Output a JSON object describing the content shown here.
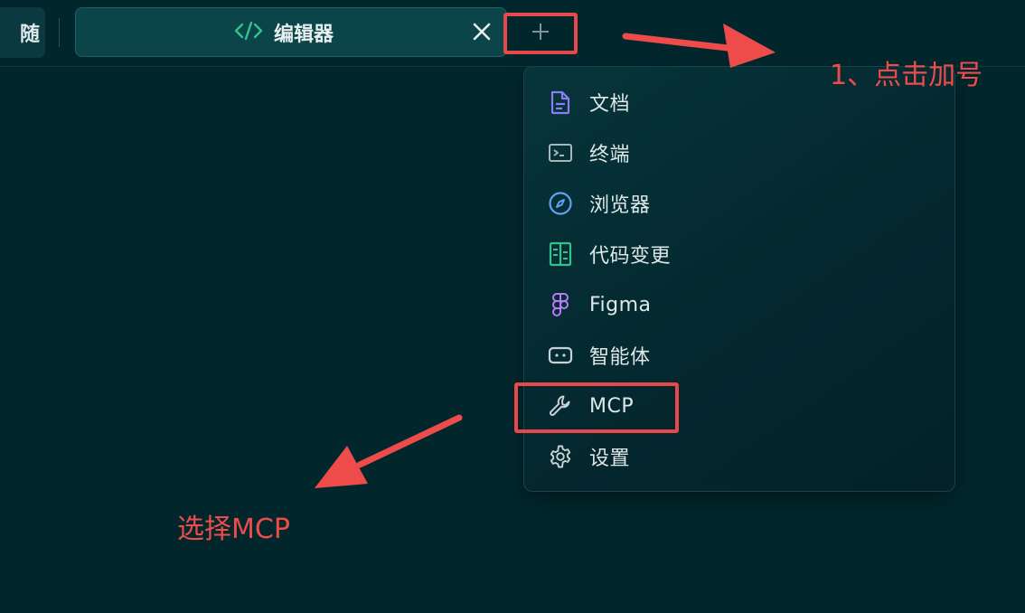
{
  "tabs": {
    "previous_label": "随",
    "active_label": "编辑器",
    "close_symbol": "✕",
    "add_symbol": "+"
  },
  "menu": {
    "items": [
      {
        "label": "文档",
        "icon": "document-icon",
        "color": "#8b7cf6"
      },
      {
        "label": "终端",
        "icon": "terminal-icon",
        "color": "#a9b6b8"
      },
      {
        "label": "浏览器",
        "icon": "compass-icon",
        "color": "#5fa3f0"
      },
      {
        "label": "代码变更",
        "icon": "diff-icon",
        "color": "#34c18c"
      },
      {
        "label": "Figma",
        "icon": "figma-icon",
        "color": "#b77cf5"
      },
      {
        "label": "智能体",
        "icon": "robot-icon",
        "color": "#c8d2d4"
      },
      {
        "label": "MCP",
        "icon": "wrench-icon",
        "color": "#c8d2d4"
      },
      {
        "label": "设置",
        "icon": "gear-icon",
        "color": "#c8d2d4"
      }
    ]
  },
  "annotations": {
    "step1": "1、点击加号",
    "step2": "选择MCP"
  },
  "colors": {
    "background": "#01272d",
    "annotation_red": "#ee4b4b",
    "accent_green": "#34c18c"
  }
}
